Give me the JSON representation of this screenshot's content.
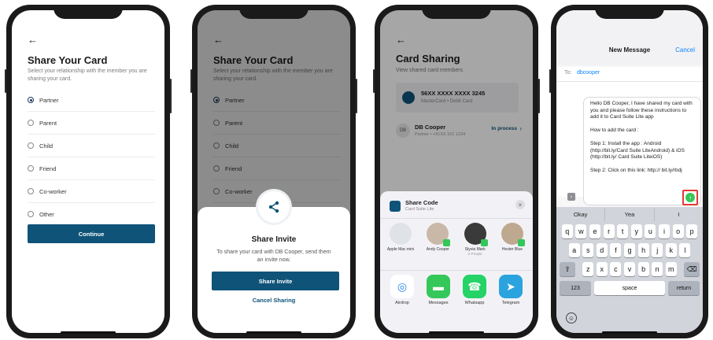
{
  "screen1": {
    "back_icon": "arrow-left-icon",
    "title": "Share Your Card",
    "subtitle": "Select your relationship with the member you are sharing your card.",
    "options": [
      "Partner",
      "Parent",
      "Child",
      "Friend",
      "Co-worker",
      "Other"
    ],
    "selected_option": "Partner",
    "continue_label": "Continue"
  },
  "screen2": {
    "back_icon": "arrow-left-icon",
    "title": "Share Your Card",
    "subtitle": "Select your relationship with the member you are sharing your card.",
    "options": [
      "Partner",
      "Parent",
      "Child",
      "Friend",
      "Co-worker",
      "Other"
    ],
    "sheet": {
      "icon": "share-icon",
      "title": "Share Invite",
      "description": "To share your card with DB Cooper, send them an invite now.",
      "primary_label": "Share Invite",
      "cancel_label": "Cancel Sharing"
    }
  },
  "screen3": {
    "back_icon": "arrow-left-icon",
    "title": "Card Sharing",
    "subtitle": "View shared card members",
    "card": {
      "number": "56XX XXXX XXXX 3245",
      "type": "MasterCard • Debit Card"
    },
    "member": {
      "initials": "DB",
      "name": "DB Cooper",
      "detail": "Partner • +91XX 101 1234",
      "status": "In process"
    },
    "share_sheet": {
      "app_name": "Share Code",
      "app_sub": "Card Suite Lite",
      "people": [
        {
          "name": "Apple Mac mini",
          "sub": ""
        },
        {
          "name": "Andy Cooper",
          "sub": ""
        },
        {
          "name": "Styvia Mark",
          "sub": "2 People"
        },
        {
          "name": "Hester Blue",
          "sub": ""
        }
      ],
      "apps": [
        "Airdrop",
        "Messages",
        "Whatsapp",
        "Telegram"
      ]
    }
  },
  "screen4": {
    "title": "New Message",
    "cancel_label": "Cancel",
    "to_label": "To:",
    "to_value": "dbcooper",
    "message": "Hello DB Cooper, I have shared my card with you and please follow these instructions to add it to Card Suite Lite app\n\nHow to add the card :\n\nStep 1: Install the app : Android (http://bit.ly/Card Suite LiteAndroid) & iOS (http://bit.ly/ Card Suite LiteiOS)\n\nStep 2: Click on this link: http:// bit.ly/rbdj",
    "suggestions": [
      "Okay",
      "Yea",
      "I"
    ],
    "keys_row1": [
      "q",
      "w",
      "e",
      "r",
      "t",
      "y",
      "u",
      "i",
      "o",
      "p"
    ],
    "keys_row2": [
      "a",
      "s",
      "d",
      "f",
      "g",
      "h",
      "j",
      "k",
      "l"
    ],
    "keys_row3": [
      "z",
      "x",
      "c",
      "v",
      "b",
      "n",
      "m"
    ],
    "key_123": "123",
    "key_space": "space",
    "key_return": "return",
    "send_icon": "send-arrow-up-icon",
    "colors": {
      "accent": "#0a84ff",
      "send": "#34c759",
      "highlight": "#e53935"
    }
  },
  "colors": {
    "primary": "#0f5378",
    "radio": "#1e3a5f"
  }
}
